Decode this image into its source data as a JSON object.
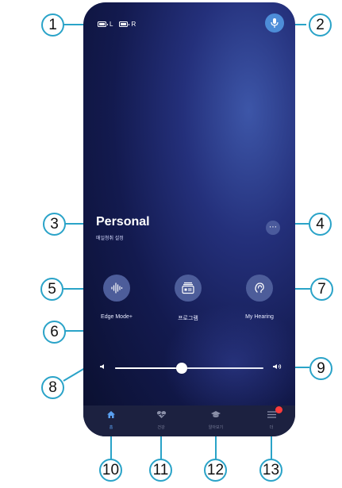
{
  "status": {
    "left": "L",
    "right": "R"
  },
  "program": {
    "title": "Personal",
    "subtitle": "매일청취 설정"
  },
  "functions": [
    {
      "label": "Edge Mode+",
      "icon": "waveform-icon"
    },
    {
      "label": "프로그램",
      "icon": "program-card-icon"
    },
    {
      "label": "My Hearing",
      "icon": "ear-icon"
    }
  ],
  "volume": {
    "level": 0.45
  },
  "nav": [
    {
      "label": "홈",
      "icon": "home-icon",
      "active": true
    },
    {
      "label": "건강",
      "icon": "heart-icon",
      "active": false
    },
    {
      "label": "알아보기",
      "icon": "graduation-cap-icon",
      "active": false
    },
    {
      "label": "더",
      "icon": "menu-icon",
      "active": false,
      "badge": true
    }
  ],
  "callouts": [
    "1",
    "2",
    "3",
    "4",
    "5",
    "6",
    "7",
    "8",
    "9",
    "10",
    "11",
    "12",
    "13"
  ],
  "colors": {
    "accent": "#4d8dd8",
    "callout": "#2aa3c8",
    "badge": "#ff3b3b"
  }
}
